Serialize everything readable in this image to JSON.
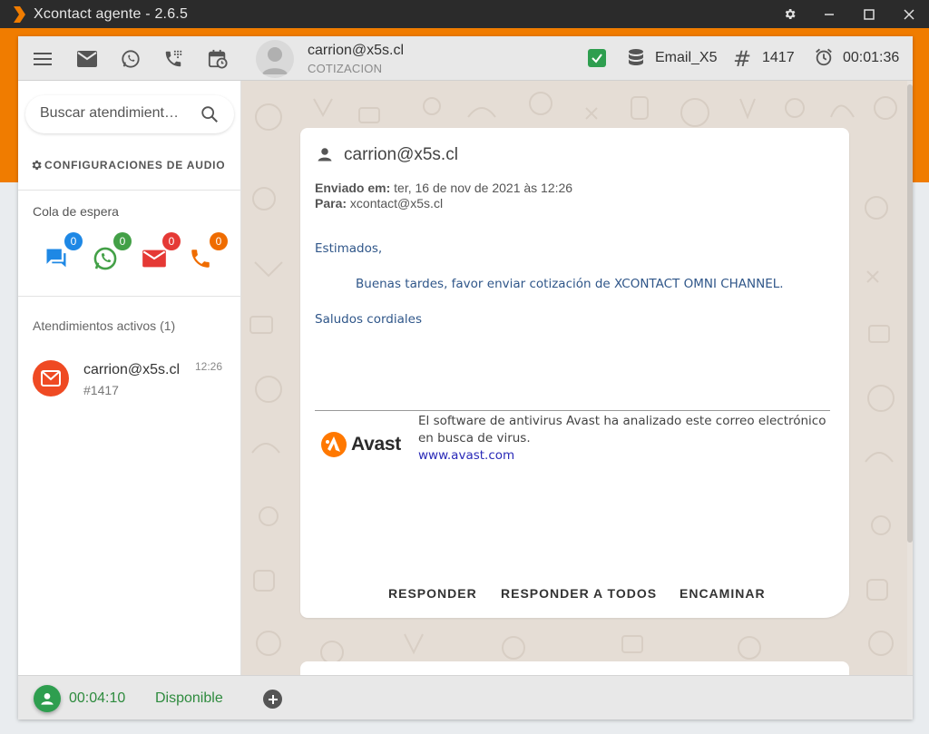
{
  "window": {
    "title": "Xcontact agente - 2.6.5"
  },
  "topbar": {
    "contact_email": "carrion@x5s.cl",
    "contact_subtitle": "COTIZACION",
    "channel": "Email_X5",
    "ticket_number": "1417",
    "timer": "00:01:36"
  },
  "sidebar": {
    "search_placeholder": "Buscar atendimient…",
    "audio_config_label": "CONFIGURACIONES DE AUDIO",
    "queue_label": "Cola de espera",
    "queue": [
      {
        "channel": "chat",
        "count": "0",
        "color": "#1e88e5",
        "badge_color": "#1e88e5"
      },
      {
        "channel": "whatsapp",
        "count": "0",
        "color": "#43a047",
        "badge_color": "#43a047"
      },
      {
        "channel": "email",
        "count": "0",
        "color": "#e53935",
        "badge_color": "#e53935"
      },
      {
        "channel": "phone",
        "count": "0",
        "color": "#ef6c00",
        "badge_color": "#ef6c00"
      }
    ],
    "active_label": "Atendimientos activos (1)",
    "active_items": [
      {
        "email": "carrion@x5s.cl",
        "ticket": "#1417",
        "time": "12:26"
      }
    ]
  },
  "email": {
    "from": "carrion@x5s.cl",
    "sent_label": "Enviado em:",
    "sent_value": "ter, 16 de nov de 2021 às 12:26",
    "to_label": "Para:",
    "to_value": "xcontact@x5s.cl",
    "greeting": "Estimados,",
    "body": "Buenas tardes, favor enviar cotización de XCONTACT OMNI CHANNEL.",
    "closing": "Saludos cordiales",
    "avast_brand": "Avast",
    "avast_text": "El software de antivirus Avast ha analizado este correo electrónico en busca de virus.",
    "avast_link": "www.avast.com",
    "actions": {
      "reply": "RESPONDER",
      "reply_all": "RESPONDER A TODOS",
      "forward": "ENCAMINAR"
    }
  },
  "bottombar": {
    "timer": "00:04:10",
    "status": "Disponible"
  },
  "colors": {
    "brand_orange": "#f07c00",
    "status_green": "#2e9e4f",
    "chat_background": "#e5ddd5",
    "gmail_red": "#ef4a23"
  }
}
